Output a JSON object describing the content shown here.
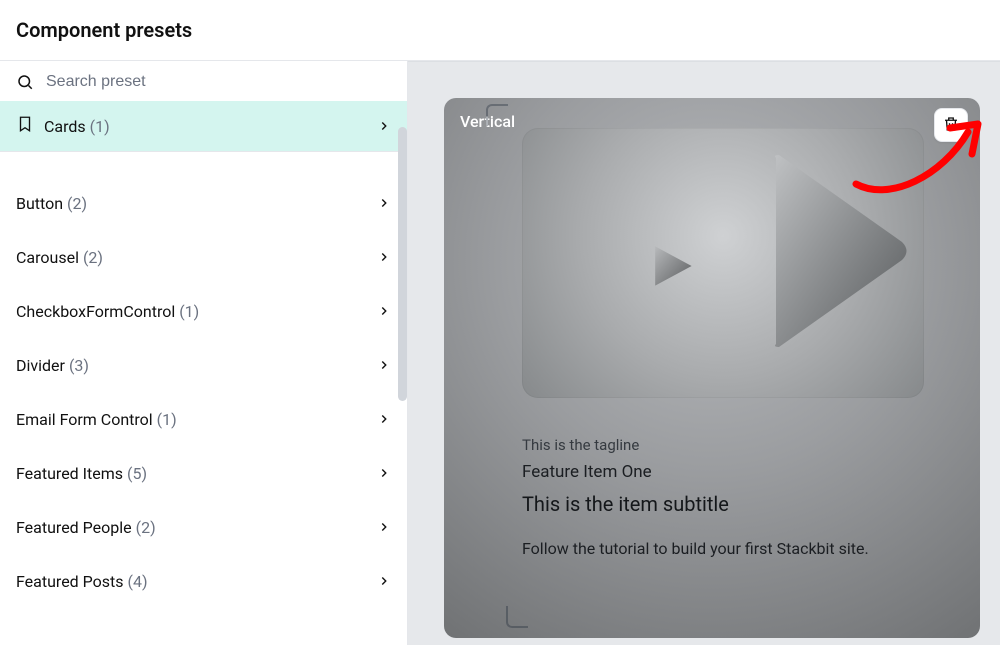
{
  "header": {
    "title": "Component presets"
  },
  "search": {
    "placeholder": "Search preset"
  },
  "active_group": {
    "label": "Cards",
    "count": "(1)"
  },
  "list": [
    {
      "label": "Button",
      "count": "(2)"
    },
    {
      "label": "Carousel",
      "count": "(2)"
    },
    {
      "label": "CheckboxFormControl",
      "count": "(1)"
    },
    {
      "label": "Divider",
      "count": "(3)"
    },
    {
      "label": "Email Form Control",
      "count": "(1)"
    },
    {
      "label": "Featured Items",
      "count": "(5)"
    },
    {
      "label": "Featured People",
      "count": "(2)"
    },
    {
      "label": "Featured Posts",
      "count": "(4)"
    }
  ],
  "preview": {
    "title": "Vertical",
    "tagline": "This is the tagline",
    "item_title": "Feature Item One",
    "subtitle": "This is the item subtitle",
    "description": "Follow the tutorial to build your first Stackbit site."
  }
}
